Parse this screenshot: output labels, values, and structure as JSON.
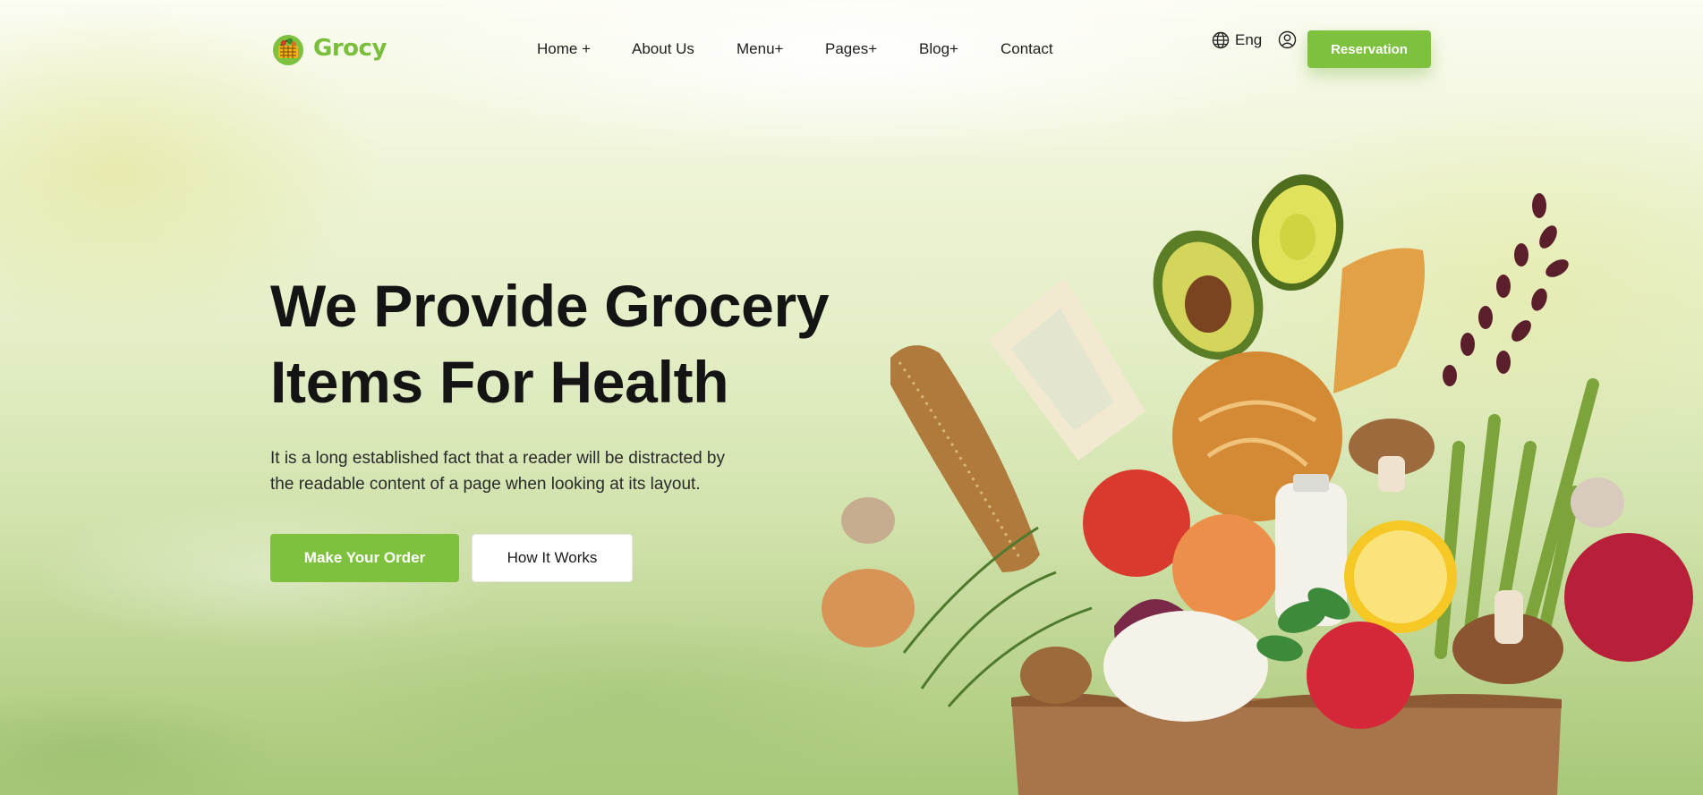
{
  "brand": {
    "name": "Grocy",
    "accent_color": "#7dc13e",
    "logo_icon": "basket-icon"
  },
  "nav": {
    "items": [
      {
        "label": "Home +"
      },
      {
        "label": "About Us"
      },
      {
        "label": "Menu+"
      },
      {
        "label": "Pages+"
      },
      {
        "label": "Blog+"
      },
      {
        "label": "Contact"
      }
    ]
  },
  "header": {
    "language_label": "Eng",
    "language_icon": "globe-icon",
    "account_icon": "user-circle-icon",
    "reservation_label": "Reservation"
  },
  "hero": {
    "title_line1": "We Provide Grocery",
    "title_line2": "Items For Health",
    "text_line1": "It is a long established fact that a reader will be distracted by",
    "text_line2": "the readable content of a page when looking at its layout.",
    "primary_button": "Make Your Order",
    "secondary_button": "How It Works",
    "image_alt": "grocery-bag-illustration"
  }
}
